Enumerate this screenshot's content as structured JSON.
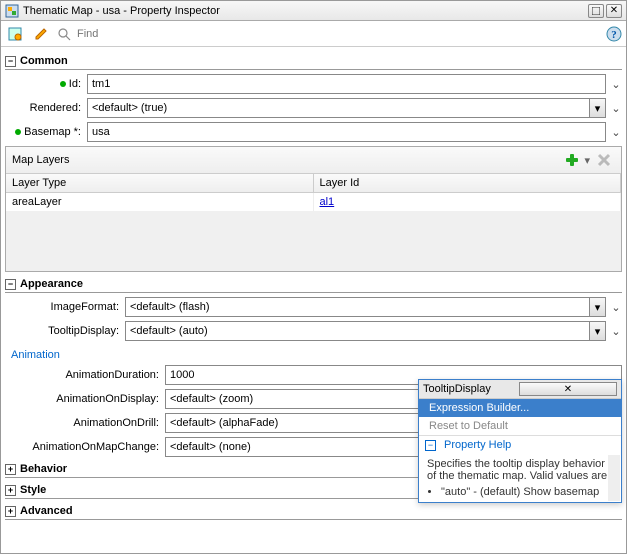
{
  "titlebar": {
    "text": "Thematic Map - usa - Property Inspector"
  },
  "toolbar": {
    "find_placeholder": "Find"
  },
  "sections": {
    "common": {
      "title": "Common",
      "id": {
        "label": "Id:",
        "value": "tm1"
      },
      "rendered": {
        "label": "Rendered:",
        "value": "<default> (true)"
      },
      "basemap": {
        "label": "Basemap *:",
        "value": "usa"
      },
      "maplayers": {
        "title": "Map Layers",
        "columns": [
          "Layer Type",
          "Layer Id"
        ],
        "rows": [
          {
            "type": "areaLayer",
            "id": "al1"
          }
        ]
      }
    },
    "appearance": {
      "title": "Appearance",
      "imageformat": {
        "label": "ImageFormat:",
        "value": "<default> (flash)"
      },
      "tooltipdisplay": {
        "label": "TooltipDisplay:",
        "value": "<default> (auto)"
      },
      "animation": {
        "title": "Animation",
        "duration": {
          "label": "AnimationDuration:",
          "value": "1000"
        },
        "ondisplay": {
          "label": "AnimationOnDisplay:",
          "value": "<default> (zoom)"
        },
        "ondrill": {
          "label": "AnimationOnDrill:",
          "value": "<default> (alphaFade)"
        },
        "onmapchange": {
          "label": "AnimationOnMapChange:",
          "value": "<default> (none)"
        }
      }
    },
    "behavior": {
      "title": "Behavior"
    },
    "style": {
      "title": "Style"
    },
    "advanced": {
      "title": "Advanced"
    }
  },
  "popup": {
    "title": "TooltipDisplay",
    "items": [
      {
        "label": "Expression Builder...",
        "state": "selected"
      },
      {
        "label": "Reset to Default",
        "state": "disabled"
      }
    ],
    "help_title": "Property Help",
    "help_text": "Specifies the tooltip display behavior of the thematic map. Valid values are:",
    "help_bullets": [
      "\"auto\" - (default) Show basemap"
    ]
  }
}
